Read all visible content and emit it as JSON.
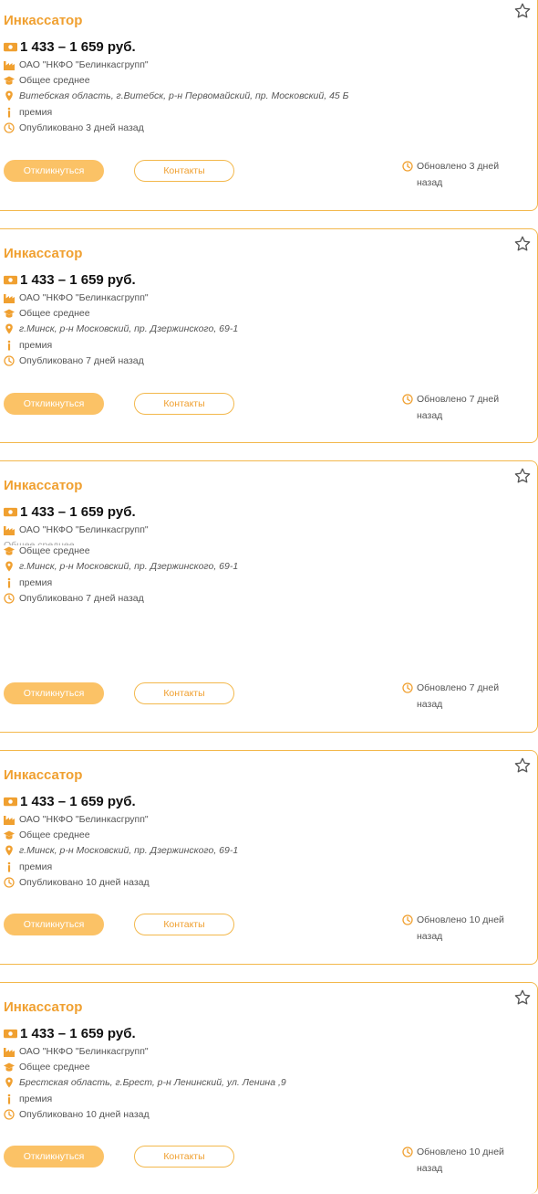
{
  "vacancies": [
    {
      "title": "Инкассатор",
      "salary": "1 433 – 1 659 руб.",
      "company": "ОАО \"НКФО \"Белинкасгрупп\"",
      "education": "Общее среднее",
      "address": "Витебская область, г.Витебск, р-н Первомайский, пр. Московский, 45 Б",
      "extra": "премия",
      "published": "Опубликовано 3 дней назад",
      "respond_label": "Откликнуться",
      "contacts_label": "Контакты",
      "updated": "Обновлено 3 дней назад"
    },
    {
      "title": "Инкассатор",
      "salary": "1 433 – 1 659 руб.",
      "company": "ОАО \"НКФО \"Белинкасгрупп\"",
      "education": "Общее среднее",
      "address": "г.Минск, р-н Московский, пр. Дзержинского, 69-1",
      "extra": "премия",
      "published": "Опубликовано 7 дней назад",
      "respond_label": "Откликнуться",
      "contacts_label": "Контакты",
      "updated": "Обновлено 7 дней назад"
    },
    {
      "title": "Инкассатор",
      "salary": "1 433 – 1 659 руб.",
      "company": "ОАО \"НКФО \"Белинкасгрупп\"",
      "education": "Общее среднее",
      "address": "г.Минск, р-н Московский, пр. Дзержинского, 69-1",
      "extra": "премия",
      "published": "Опубликовано 7 дней назад",
      "respond_label": "Откликнуться",
      "contacts_label": "Контакты",
      "updated": "Обновлено 7 дней назад"
    },
    {
      "title": "Инкассатор",
      "salary": "1 433 – 1 659 руб.",
      "company": "ОАО \"НКФО \"Белинкасгрупп\"",
      "education": "Общее среднее",
      "address": "г.Минск, р-н Московский, пр. Дзержинского, 69-1",
      "extra": "премия",
      "published": "Опубликовано 10 дней назад",
      "respond_label": "Откликнуться",
      "contacts_label": "Контакты",
      "updated": "Обновлено 10 дней назад"
    },
    {
      "title": "Инкассатор",
      "salary": "1 433 – 1 659 руб.",
      "company": "ОАО \"НКФО \"Белинкасгрупп\"",
      "education": "Общее среднее",
      "address": "Брестская область, г.Брест, р-н Ленинский, ул. Ленина ,9",
      "extra": "премия",
      "published": "Опубликовано 10 дней назад",
      "respond_label": "Откликнуться",
      "contacts_label": "Контакты",
      "updated": "Обновлено 10 дней назад"
    }
  ],
  "colors": {
    "accent": "#f0a030",
    "button_fill": "#fbc266",
    "border": "#f3b84c",
    "salary_text": "#111111",
    "body_text": "#555555"
  },
  "icons": {
    "favorite": "star-outline-icon",
    "salary": "money-icon",
    "company": "factory-icon",
    "education": "graduation-cap-icon",
    "address": "map-pin-icon",
    "extra": "info-icon",
    "published": "clock-icon",
    "updated": "clock-icon"
  }
}
